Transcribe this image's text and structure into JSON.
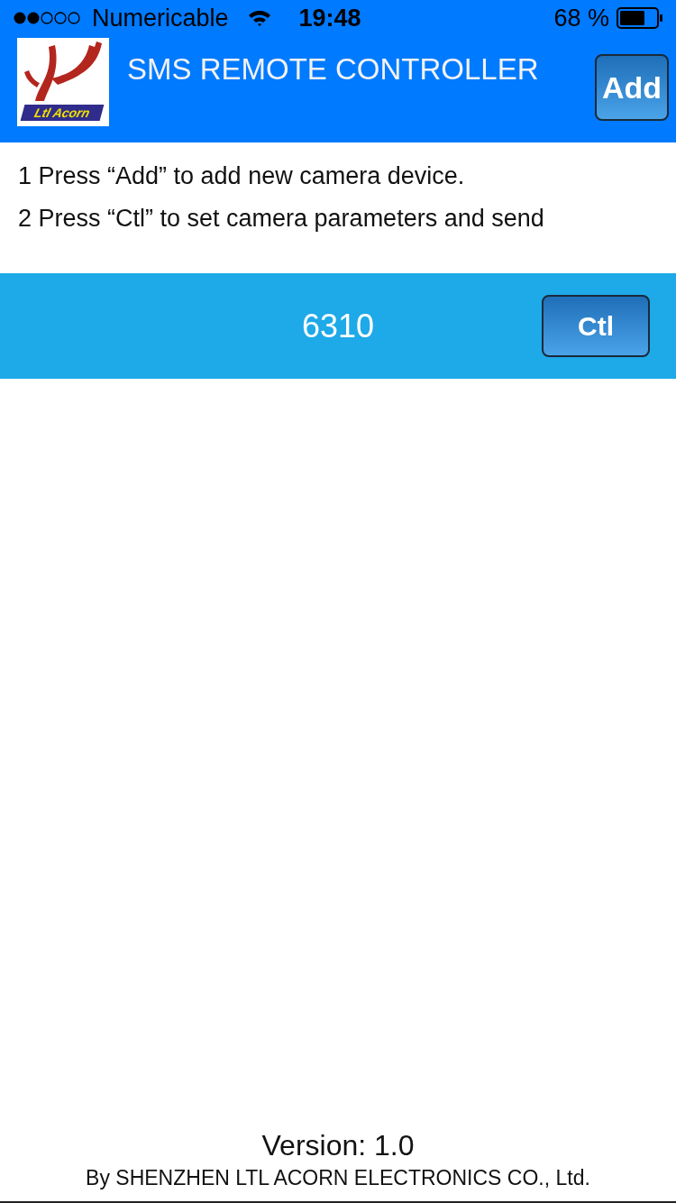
{
  "status_bar": {
    "carrier": "Numericable",
    "time": "19:48",
    "battery": "68 %"
  },
  "header": {
    "logo_text": "Ltl Acorn",
    "title": "SMS REMOTE CONTROLLER",
    "button": "Add"
  },
  "instructions": [
    "1 Press “Add” to add new camera device.",
    "2 Press “Ctl” to set camera parameters and send"
  ],
  "devices": [
    {
      "name": "6310",
      "button": "Ctl"
    }
  ],
  "footer": {
    "version": "Version: 1.0",
    "company": "By SHENZHEN LTL ACORN ELECTRONICS CO., Ltd."
  }
}
